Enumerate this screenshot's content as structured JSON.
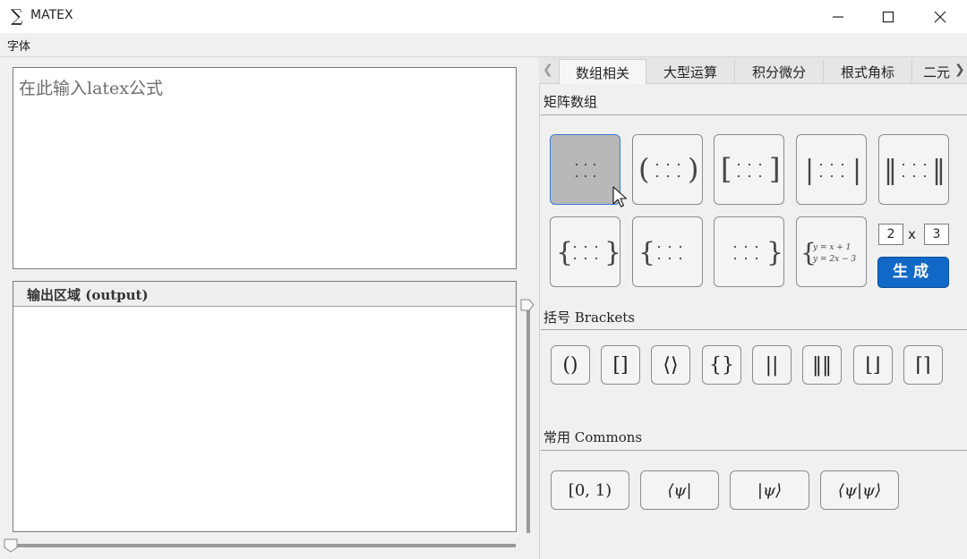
{
  "window": {
    "icon_glyph": "∑",
    "title": "MATEX"
  },
  "menu": {
    "font": "字体"
  },
  "editor": {
    "placeholder": "在此输入latex公式"
  },
  "output": {
    "header": "输出区域 (output)"
  },
  "tabs": [
    {
      "label": "数组相关",
      "active": true
    },
    {
      "label": "大型运算",
      "active": false
    },
    {
      "label": "积分微分",
      "active": false
    },
    {
      "label": "根式角标",
      "active": false
    },
    {
      "label": "二元",
      "active": false
    }
  ],
  "sections": {
    "matrix": "矩阵数组",
    "brackets": "括号 Brackets",
    "commons": "常用 Commons"
  },
  "matrix_buttons": [
    {
      "name": "plain-matrix",
      "left": "",
      "right": ""
    },
    {
      "name": "paren-matrix",
      "left": "(",
      "right": ")"
    },
    {
      "name": "bracket-matrix",
      "left": "[",
      "right": "]"
    },
    {
      "name": "vbar-matrix",
      "left": "|",
      "right": "|"
    },
    {
      "name": "double-vbar-matrix",
      "left": "‖",
      "right": "‖"
    },
    {
      "name": "brace-matrix",
      "left": "{",
      "right": "}"
    },
    {
      "name": "left-brace-matrix",
      "left": "{",
      "right": ""
    },
    {
      "name": "right-brace-matrix",
      "left": "",
      "right": "}"
    }
  ],
  "cases_button": {
    "line1": "y = x + 1",
    "line2": "y = 2x − 3"
  },
  "dims": {
    "rows": "2",
    "times": "x",
    "cols": "3"
  },
  "generate_label": "生成",
  "bracket_buttons": [
    "()",
    "[]",
    "⟨⟩",
    "{}",
    "||",
    "‖‖",
    "⌊⌋",
    "⌈⌉"
  ],
  "common_buttons": [
    "[0, 1)",
    "⟨ψ|",
    "|ψ⟩",
    "⟨ψ|ψ⟩"
  ],
  "colors": {
    "accent": "#1168c6",
    "selected": "#b8b8b8"
  }
}
